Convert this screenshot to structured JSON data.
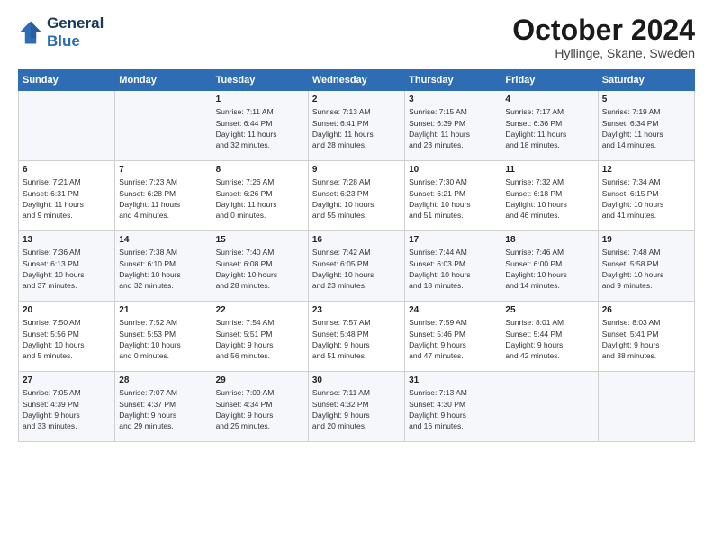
{
  "logo": {
    "line1": "General",
    "line2": "Blue"
  },
  "title": "October 2024",
  "subtitle": "Hyllinge, Skane, Sweden",
  "days_of_week": [
    "Sunday",
    "Monday",
    "Tuesday",
    "Wednesday",
    "Thursday",
    "Friday",
    "Saturday"
  ],
  "weeks": [
    [
      {
        "num": "",
        "info": ""
      },
      {
        "num": "",
        "info": ""
      },
      {
        "num": "1",
        "info": "Sunrise: 7:11 AM\nSunset: 6:44 PM\nDaylight: 11 hours\nand 32 minutes."
      },
      {
        "num": "2",
        "info": "Sunrise: 7:13 AM\nSunset: 6:41 PM\nDaylight: 11 hours\nand 28 minutes."
      },
      {
        "num": "3",
        "info": "Sunrise: 7:15 AM\nSunset: 6:39 PM\nDaylight: 11 hours\nand 23 minutes."
      },
      {
        "num": "4",
        "info": "Sunrise: 7:17 AM\nSunset: 6:36 PM\nDaylight: 11 hours\nand 18 minutes."
      },
      {
        "num": "5",
        "info": "Sunrise: 7:19 AM\nSunset: 6:34 PM\nDaylight: 11 hours\nand 14 minutes."
      }
    ],
    [
      {
        "num": "6",
        "info": "Sunrise: 7:21 AM\nSunset: 6:31 PM\nDaylight: 11 hours\nand 9 minutes."
      },
      {
        "num": "7",
        "info": "Sunrise: 7:23 AM\nSunset: 6:28 PM\nDaylight: 11 hours\nand 4 minutes."
      },
      {
        "num": "8",
        "info": "Sunrise: 7:26 AM\nSunset: 6:26 PM\nDaylight: 11 hours\nand 0 minutes."
      },
      {
        "num": "9",
        "info": "Sunrise: 7:28 AM\nSunset: 6:23 PM\nDaylight: 10 hours\nand 55 minutes."
      },
      {
        "num": "10",
        "info": "Sunrise: 7:30 AM\nSunset: 6:21 PM\nDaylight: 10 hours\nand 51 minutes."
      },
      {
        "num": "11",
        "info": "Sunrise: 7:32 AM\nSunset: 6:18 PM\nDaylight: 10 hours\nand 46 minutes."
      },
      {
        "num": "12",
        "info": "Sunrise: 7:34 AM\nSunset: 6:15 PM\nDaylight: 10 hours\nand 41 minutes."
      }
    ],
    [
      {
        "num": "13",
        "info": "Sunrise: 7:36 AM\nSunset: 6:13 PM\nDaylight: 10 hours\nand 37 minutes."
      },
      {
        "num": "14",
        "info": "Sunrise: 7:38 AM\nSunset: 6:10 PM\nDaylight: 10 hours\nand 32 minutes."
      },
      {
        "num": "15",
        "info": "Sunrise: 7:40 AM\nSunset: 6:08 PM\nDaylight: 10 hours\nand 28 minutes."
      },
      {
        "num": "16",
        "info": "Sunrise: 7:42 AM\nSunset: 6:05 PM\nDaylight: 10 hours\nand 23 minutes."
      },
      {
        "num": "17",
        "info": "Sunrise: 7:44 AM\nSunset: 6:03 PM\nDaylight: 10 hours\nand 18 minutes."
      },
      {
        "num": "18",
        "info": "Sunrise: 7:46 AM\nSunset: 6:00 PM\nDaylight: 10 hours\nand 14 minutes."
      },
      {
        "num": "19",
        "info": "Sunrise: 7:48 AM\nSunset: 5:58 PM\nDaylight: 10 hours\nand 9 minutes."
      }
    ],
    [
      {
        "num": "20",
        "info": "Sunrise: 7:50 AM\nSunset: 5:56 PM\nDaylight: 10 hours\nand 5 minutes."
      },
      {
        "num": "21",
        "info": "Sunrise: 7:52 AM\nSunset: 5:53 PM\nDaylight: 10 hours\nand 0 minutes."
      },
      {
        "num": "22",
        "info": "Sunrise: 7:54 AM\nSunset: 5:51 PM\nDaylight: 9 hours\nand 56 minutes."
      },
      {
        "num": "23",
        "info": "Sunrise: 7:57 AM\nSunset: 5:48 PM\nDaylight: 9 hours\nand 51 minutes."
      },
      {
        "num": "24",
        "info": "Sunrise: 7:59 AM\nSunset: 5:46 PM\nDaylight: 9 hours\nand 47 minutes."
      },
      {
        "num": "25",
        "info": "Sunrise: 8:01 AM\nSunset: 5:44 PM\nDaylight: 9 hours\nand 42 minutes."
      },
      {
        "num": "26",
        "info": "Sunrise: 8:03 AM\nSunset: 5:41 PM\nDaylight: 9 hours\nand 38 minutes."
      }
    ],
    [
      {
        "num": "27",
        "info": "Sunrise: 7:05 AM\nSunset: 4:39 PM\nDaylight: 9 hours\nand 33 minutes."
      },
      {
        "num": "28",
        "info": "Sunrise: 7:07 AM\nSunset: 4:37 PM\nDaylight: 9 hours\nand 29 minutes."
      },
      {
        "num": "29",
        "info": "Sunrise: 7:09 AM\nSunset: 4:34 PM\nDaylight: 9 hours\nand 25 minutes."
      },
      {
        "num": "30",
        "info": "Sunrise: 7:11 AM\nSunset: 4:32 PM\nDaylight: 9 hours\nand 20 minutes."
      },
      {
        "num": "31",
        "info": "Sunrise: 7:13 AM\nSunset: 4:30 PM\nDaylight: 9 hours\nand 16 minutes."
      },
      {
        "num": "",
        "info": ""
      },
      {
        "num": "",
        "info": ""
      }
    ]
  ]
}
